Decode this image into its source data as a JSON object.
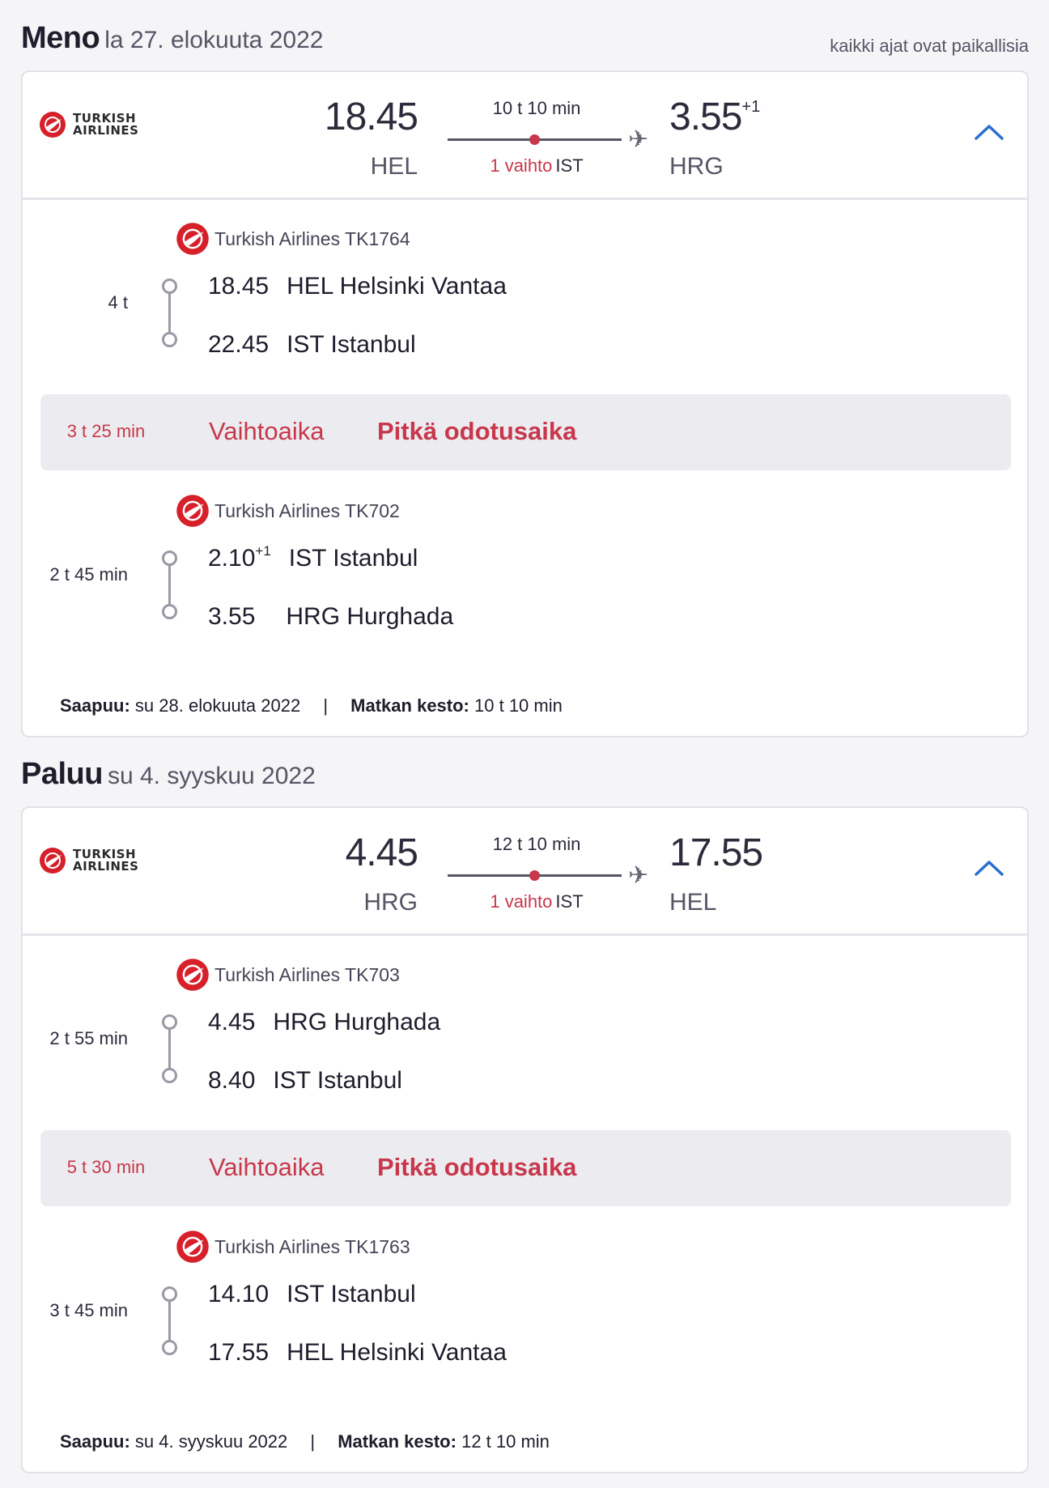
{
  "note": "kaikki ajat ovat paikallisia",
  "outbound": {
    "title": "Meno",
    "date": "la 27. elokuuta 2022",
    "airline_logo_text": [
      "TURKISH",
      "AIRLINES"
    ],
    "dep_time": "18.45",
    "dep_code": "HEL",
    "duration": "10 t 10 min",
    "stops": "1 vaihto",
    "stop_airport": "IST",
    "arr_time": "3.55",
    "arr_dayoffset": "+1",
    "arr_code": "HRG",
    "segments": [
      {
        "airline": "Turkish Airlines TK1764",
        "duration": "4 t",
        "from_time": "18.45",
        "from_offset": "",
        "from_place": "HEL Helsinki Vantaa",
        "to_time": "22.45",
        "to_offset": "",
        "to_place": "IST Istanbul"
      },
      {
        "airline": "Turkish Airlines TK702",
        "duration": "2 t 45 min",
        "from_time": "2.10",
        "from_offset": "+1",
        "from_place": "IST Istanbul",
        "to_time": "3.55",
        "to_offset": "",
        "to_place": "HRG Hurghada"
      }
    ],
    "layover": {
      "duration": "3 t 25 min",
      "label": "Vaihtoaika",
      "warning": "Pitkä odotusaika"
    },
    "summary": {
      "arrives_label": "Saapuu:",
      "arrives_value": "su 28. elokuuta 2022",
      "separator": "|",
      "total_label": "Matkan kesto:",
      "total_value": "10 t 10 min"
    }
  },
  "inbound": {
    "title": "Paluu",
    "date": "su 4. syyskuu 2022",
    "airline_logo_text": [
      "TURKISH",
      "AIRLINES"
    ],
    "dep_time": "4.45",
    "dep_code": "HRG",
    "duration": "12 t 10 min",
    "stops": "1 vaihto",
    "stop_airport": "IST",
    "arr_time": "17.55",
    "arr_dayoffset": "",
    "arr_code": "HEL",
    "segments": [
      {
        "airline": "Turkish Airlines TK703",
        "duration": "2 t 55 min",
        "from_time": "4.45",
        "from_offset": "",
        "from_place": "HRG Hurghada",
        "to_time": "8.40",
        "to_offset": "",
        "to_place": "IST Istanbul"
      },
      {
        "airline": "Turkish Airlines TK1763",
        "duration": "3 t 45 min",
        "from_time": "14.10",
        "from_offset": "",
        "from_place": "IST Istanbul",
        "to_time": "17.55",
        "to_offset": "",
        "to_place": "HEL Helsinki Vantaa"
      }
    ],
    "layover": {
      "duration": "5 t 30 min",
      "label": "Vaihtoaika",
      "warning": "Pitkä odotusaika"
    },
    "summary": {
      "arrives_label": "Saapuu:",
      "arrives_value": "su 4. syyskuu 2022",
      "separator": "|",
      "total_label": "Matkan kesto:",
      "total_value": "12 t 10 min"
    }
  },
  "colors": {
    "accent_red": "#c8374b",
    "chevron_blue": "#2a6fd1",
    "logo_red": "#d6202a"
  }
}
